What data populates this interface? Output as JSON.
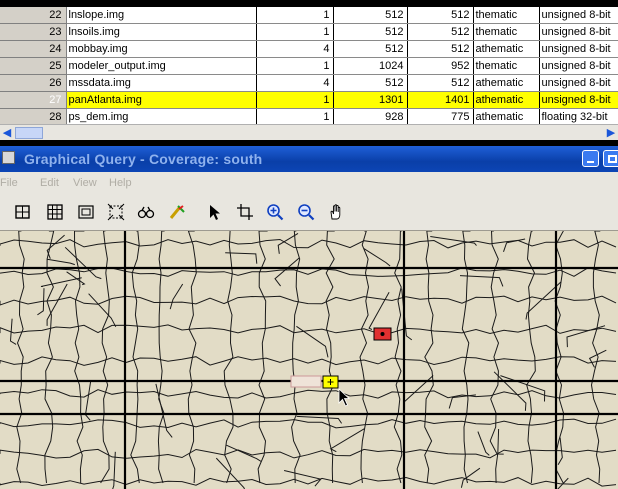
{
  "table": {
    "rows": [
      {
        "num": "22",
        "name": "lnslope.img",
        "bands": "1",
        "cols": "512",
        "rows": "512",
        "type": "thematic",
        "data_type": "unsigned 8-bit",
        "selected": false
      },
      {
        "num": "23",
        "name": "lnsoils.img",
        "bands": "1",
        "cols": "512",
        "rows": "512",
        "type": "thematic",
        "data_type": "unsigned 8-bit",
        "selected": false
      },
      {
        "num": "24",
        "name": "mobbay.img",
        "bands": "4",
        "cols": "512",
        "rows": "512",
        "type": "athematic",
        "data_type": "unsigned 8-bit",
        "selected": false
      },
      {
        "num": "25",
        "name": "modeler_output.img",
        "bands": "1",
        "cols": "1024",
        "rows": "952",
        "type": "thematic",
        "data_type": "unsigned 8-bit",
        "selected": false
      },
      {
        "num": "26",
        "name": "mssdata.img",
        "bands": "4",
        "cols": "512",
        "rows": "512",
        "type": "athematic",
        "data_type": "unsigned 8-bit",
        "selected": false
      },
      {
        "num": "27",
        "name": "panAtlanta.img",
        "bands": "1",
        "cols": "1301",
        "rows": "1401",
        "type": "athematic",
        "data_type": "unsigned 8-bit",
        "selected": true
      },
      {
        "num": "28",
        "name": "ps_dem.img",
        "bands": "1",
        "cols": "928",
        "rows": "775",
        "type": "athematic",
        "data_type": "floating 32-bit",
        "selected": false
      }
    ],
    "selected_row_color": "#ffff00"
  },
  "hscroll": {
    "left_icon": "scroll-left-icon",
    "right_icon": "scroll-right-icon"
  },
  "window": {
    "title": "Graphical Query - Coverage: south",
    "title_color": "#1f5fd8",
    "buttons": {
      "minimize_icon": "minimize-icon",
      "close_icon": "close-icon"
    }
  },
  "menu": {
    "file": "File",
    "edit": "Edit",
    "view": "View",
    "help": "Help"
  },
  "toolbar": {
    "icons": [
      "select-window-icon",
      "table-icon",
      "frame-icon",
      "extent-icon",
      "binoculars-icon",
      "clear-selection-icon",
      "arrow-pointer-icon",
      "crop-icon",
      "zoom-in-icon",
      "zoom-out-icon",
      "pan-hand-icon"
    ]
  },
  "map": {
    "background": "#e2dcc6",
    "selected_red_color": "#e03030",
    "selected_yellow_color": "#ffff00"
  }
}
